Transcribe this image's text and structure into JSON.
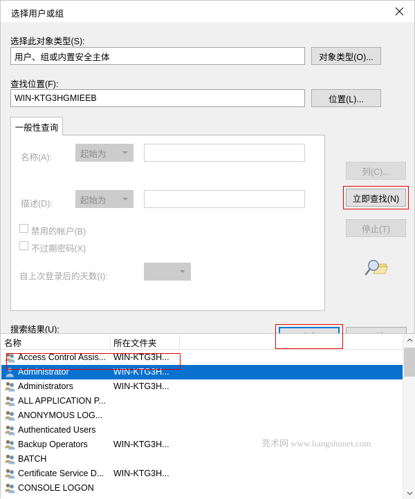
{
  "window": {
    "title": "选择用户或组",
    "close_icon": "close-icon"
  },
  "object_type": {
    "label": "选择此对象类型(S):",
    "value": "用户、组或内置安全主体",
    "button": "对象类型(O)..."
  },
  "location": {
    "label": "查找位置(F):",
    "value": "WIN-KTG3HGMIEEB",
    "button": "位置(L)..."
  },
  "tabs": [
    {
      "label": "一般性查询",
      "active": true
    }
  ],
  "query": {
    "name_label": "名称(A):",
    "name_condition": "起始为",
    "name_value": "",
    "desc_label": "描述(D):",
    "desc_condition": "起始为",
    "desc_value": "",
    "disabled_accounts_label": "禁用的帐户(B)",
    "disabled_accounts_checked": false,
    "nonexpiring_password_label": "不过期密码(X)",
    "nonexpiring_password_checked": false,
    "days_since_logon_label": "自上次登录后的天数(I):",
    "days_since_logon_value": ""
  },
  "side_buttons": {
    "columns": "列(C)...",
    "find_now": "立即查找(N)",
    "stop": "停止(T)",
    "magnifier_icon": "magnifier-search-icon"
  },
  "dialog_buttons": {
    "ok": "确定",
    "cancel": "取消"
  },
  "results": {
    "label": "搜索结果(U):",
    "columns": [
      "名称",
      "所在文件夹"
    ],
    "rows": [
      {
        "icon": "group-icon",
        "name": "Access Control Assis...",
        "folder": "WIN-KTG3H...",
        "selected": false
      },
      {
        "icon": "user-icon",
        "name": "Administrator",
        "folder": "WIN-KTG3H...",
        "selected": true
      },
      {
        "icon": "group-icon",
        "name": "Administrators",
        "folder": "WIN-KTG3H...",
        "selected": false
      },
      {
        "icon": "group-icon",
        "name": "ALL APPLICATION P...",
        "folder": "",
        "selected": false
      },
      {
        "icon": "group-icon",
        "name": "ANONYMOUS LOG...",
        "folder": "",
        "selected": false
      },
      {
        "icon": "group-icon",
        "name": "Authenticated Users",
        "folder": "",
        "selected": false
      },
      {
        "icon": "group-icon",
        "name": "Backup Operators",
        "folder": "WIN-KTG3H...",
        "selected": false
      },
      {
        "icon": "group-icon",
        "name": "BATCH",
        "folder": "",
        "selected": false
      },
      {
        "icon": "group-icon",
        "name": "Certificate Service D...",
        "folder": "WIN-KTG3H...",
        "selected": false
      },
      {
        "icon": "group-icon",
        "name": "CONSOLE LOGON",
        "folder": "",
        "selected": false
      }
    ]
  },
  "scrollbar": {
    "up_arrow": "^",
    "down_arrow": "v"
  },
  "watermark": "亮术网 www.liangshunet.com",
  "colors": {
    "selection": "#0b71cf",
    "annotation": "#e60000",
    "focus": "#0078d7"
  }
}
